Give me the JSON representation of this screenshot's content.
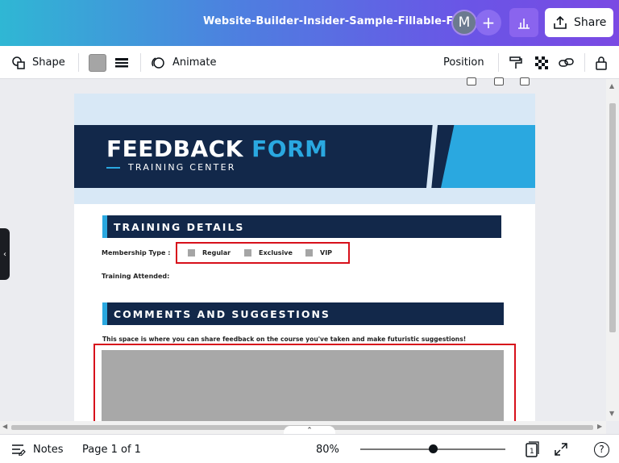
{
  "header": {
    "doc_title": "Website-Builder-Insider-Sample-Fillable-Form",
    "avatar_initial": "M",
    "add_label": "+",
    "share_label": "Share"
  },
  "toolbar": {
    "shape_label": "Shape",
    "animate_label": "Animate",
    "position_label": "Position",
    "swatch_color": "#a5a5a5"
  },
  "document": {
    "title_main": "FEEDBACK",
    "title_accent": "FORM",
    "subtitle": "TRAINING CENTER",
    "section1": "TRAINING DETAILS",
    "membership_label": "Membership Type :",
    "options": [
      "Regular",
      "Exclusive",
      "VIP"
    ],
    "training_label": "Training Attended:",
    "section2": "COMMENTS AND SUGGESTIONS",
    "comments_prompt": "This space is where you can share feedback on the course you've taken and make futuristic suggestions!",
    "colors": {
      "navy": "#12284a",
      "accent": "#2aa8e0",
      "highlight": "#d7101b"
    }
  },
  "footer": {
    "notes_label": "Notes",
    "page_label": "Page 1 of 1",
    "zoom": "80%",
    "zoom_fraction": 0.5,
    "page_count": "1",
    "help": "?"
  }
}
